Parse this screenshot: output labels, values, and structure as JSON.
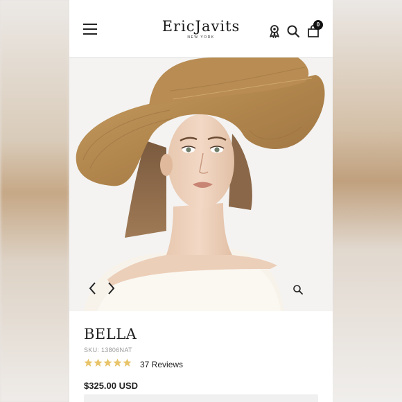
{
  "brand": {
    "name": "EricJavits",
    "location": "NEW YORK"
  },
  "header": {
    "menu_icon": "hamburger-menu-icon",
    "rewards_icon": "award-ribbon-icon",
    "search_icon": "search-icon",
    "cart_icon": "shopping-bag-icon",
    "cart_count": "0"
  },
  "gallery": {
    "prev_icon": "chevron-left-icon",
    "next_icon": "chevron-right-icon",
    "zoom_icon": "zoom-icon"
  },
  "product": {
    "title": "BELLA",
    "sku": "SKU: 13806NAT",
    "rating": 5,
    "reviews": "37 Reviews",
    "price": "$325.00 USD"
  },
  "colors": {
    "star": "#e8c46a",
    "hat": "#b5894f",
    "text": "#222222"
  }
}
